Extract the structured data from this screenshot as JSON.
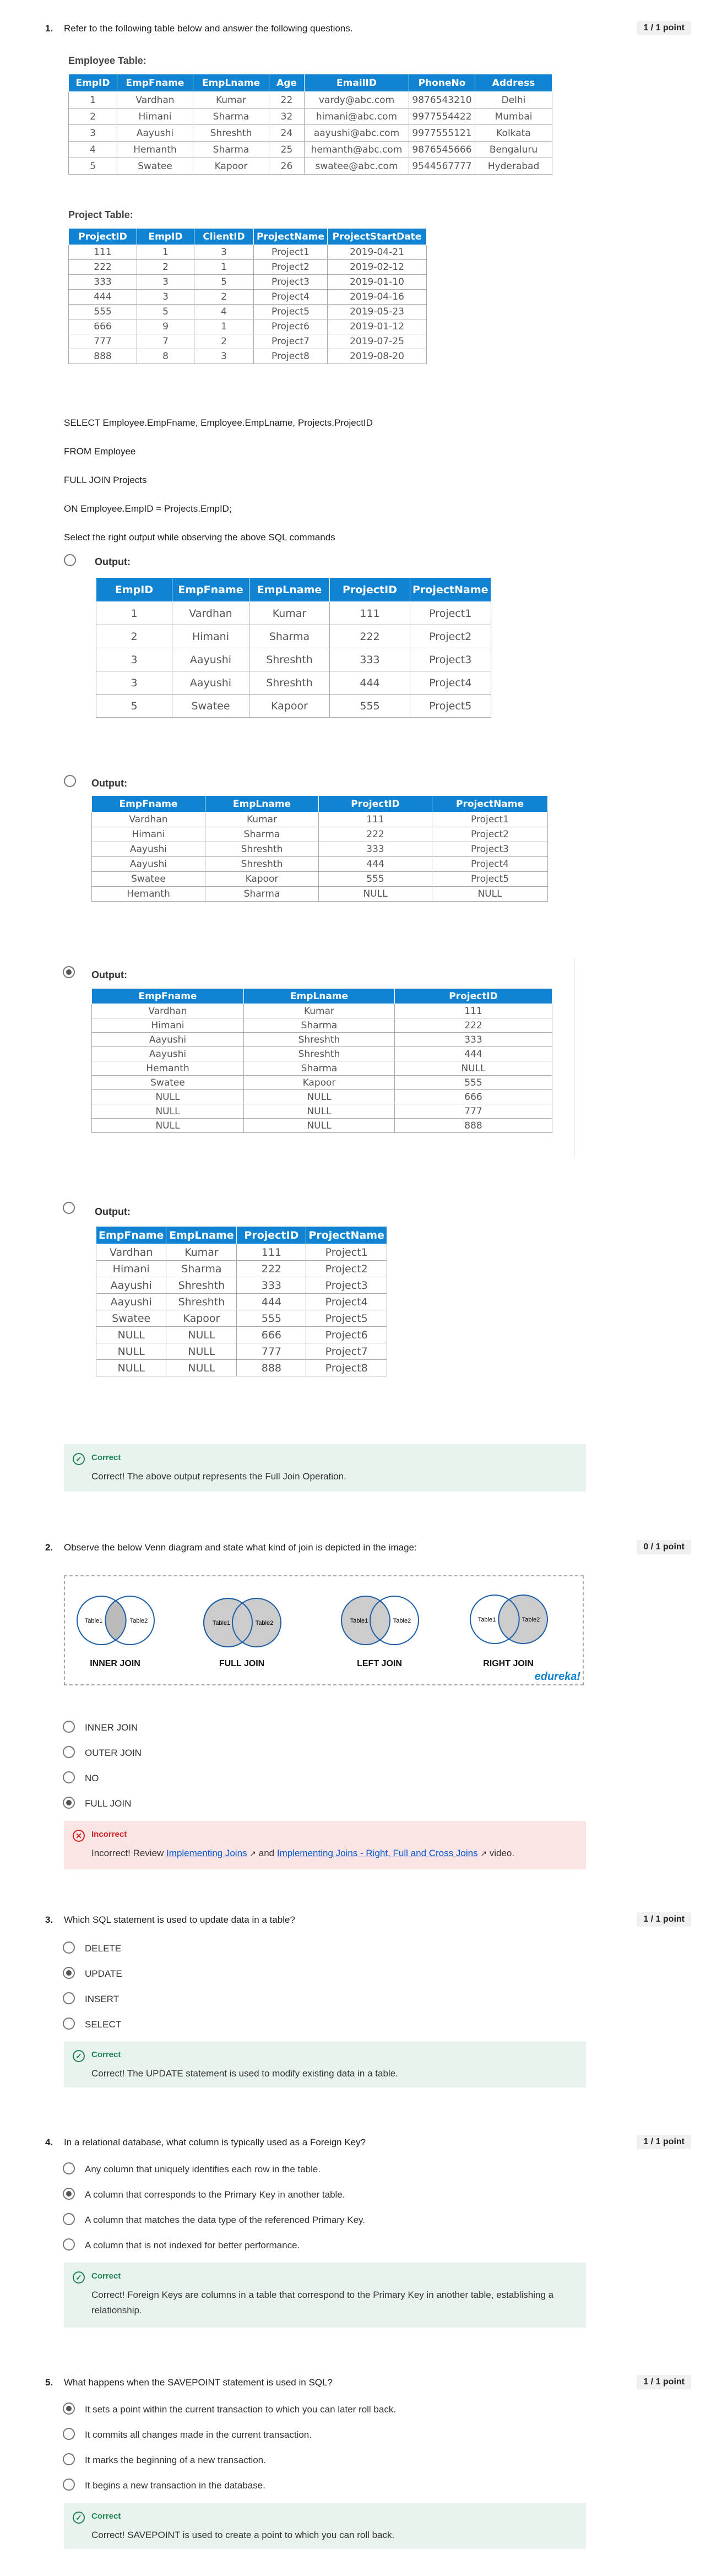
{
  "q1": {
    "number": "1.",
    "question": "Refer to the following table below and answer the following questions.",
    "points": "1 / 1 point",
    "employee_table": {
      "title": "Employee Table:",
      "headers": [
        "EmpID",
        "EmpFname",
        "EmpLname",
        "Age",
        "EmailID",
        "PhoneNo",
        "Address"
      ],
      "rows": [
        [
          "1",
          "Vardhan",
          "Kumar",
          "22",
          "vardy@abc.com",
          "9876543210",
          "Delhi"
        ],
        [
          "2",
          "Himani",
          "Sharma",
          "32",
          "himani@abc.com",
          "9977554422",
          "Mumbai"
        ],
        [
          "3",
          "Aayushi",
          "Shreshth",
          "24",
          "aayushi@abc.com",
          "9977555121",
          "Kolkata"
        ],
        [
          "4",
          "Hemanth",
          "Sharma",
          "25",
          "hemanth@abc.com",
          "9876545666",
          "Bengaluru"
        ],
        [
          "5",
          "Swatee",
          "Kapoor",
          "26",
          "swatee@abc.com",
          "9544567777",
          "Hyderabad"
        ]
      ]
    },
    "project_table": {
      "title": "Project Table:",
      "headers": [
        "ProjectID",
        "EmpID",
        "ClientID",
        "ProjectName",
        "ProjectStartDate"
      ],
      "rows": [
        [
          "111",
          "1",
          "3",
          "Project1",
          "2019-04-21"
        ],
        [
          "222",
          "2",
          "1",
          "Project2",
          "2019-02-12"
        ],
        [
          "333",
          "3",
          "5",
          "Project3",
          "2019-01-10"
        ],
        [
          "444",
          "3",
          "2",
          "Project4",
          "2019-04-16"
        ],
        [
          "555",
          "5",
          "4",
          "Project5",
          "2019-05-23"
        ],
        [
          "666",
          "9",
          "1",
          "Project6",
          "2019-01-12"
        ],
        [
          "777",
          "7",
          "2",
          "Project7",
          "2019-07-25"
        ],
        [
          "888",
          "8",
          "3",
          "Project8",
          "2019-08-20"
        ]
      ]
    },
    "sql": [
      "SELECT Employee.EmpFname, Employee.EmpLname, Projects.ProjectID",
      "FROM Employee",
      "FULL JOIN Projects",
      "ON Employee.EmpID = Projects.EmpID;",
      "Select the right output while observing the above SQL commands"
    ],
    "options": [
      {
        "label": "Output:",
        "selected": false,
        "headers": [
          "EmpID",
          "EmpFname",
          "EmpLname",
          "ProjectID",
          "ProjectName"
        ],
        "rows": [
          [
            "1",
            "Vardhan",
            "Kumar",
            "111",
            "Project1"
          ],
          [
            "2",
            "Himani",
            "Sharma",
            "222",
            "Project2"
          ],
          [
            "3",
            "Aayushi",
            "Shreshth",
            "333",
            "Project3"
          ],
          [
            "3",
            "Aayushi",
            "Shreshth",
            "444",
            "Project4"
          ],
          [
            "5",
            "Swatee",
            "Kapoor",
            "555",
            "Project5"
          ]
        ]
      },
      {
        "label": "Output:",
        "selected": false,
        "headers": [
          "EmpFname",
          "EmpLname",
          "ProjectID",
          "ProjectName"
        ],
        "rows": [
          [
            "Vardhan",
            "Kumar",
            "111",
            "Project1"
          ],
          [
            "Himani",
            "Sharma",
            "222",
            "Project2"
          ],
          [
            "Aayushi",
            "Shreshth",
            "333",
            "Project3"
          ],
          [
            "Aayushi",
            "Shreshth",
            "444",
            "Project4"
          ],
          [
            "Swatee",
            "Kapoor",
            "555",
            "Project5"
          ],
          [
            "Hemanth",
            "Sharma",
            "NULL",
            "NULL"
          ]
        ]
      },
      {
        "label": "Output:",
        "selected": true,
        "headers": [
          "EmpFname",
          "EmpLname",
          "ProjectID"
        ],
        "rows": [
          [
            "Vardhan",
            "Kumar",
            "111"
          ],
          [
            "Himani",
            "Sharma",
            "222"
          ],
          [
            "Aayushi",
            "Shreshth",
            "333"
          ],
          [
            "Aayushi",
            "Shreshth",
            "444"
          ],
          [
            "Hemanth",
            "Sharma",
            "NULL"
          ],
          [
            "Swatee",
            "Kapoor",
            "555"
          ],
          [
            "NULL",
            "NULL",
            "666"
          ],
          [
            "NULL",
            "NULL",
            "777"
          ],
          [
            "NULL",
            "NULL",
            "888"
          ]
        ]
      },
      {
        "label": "Output:",
        "selected": false,
        "headers": [
          "EmpFname",
          "EmpLname",
          "ProjectID",
          "ProjectName"
        ],
        "rows": [
          [
            "Vardhan",
            "Kumar",
            "111",
            "Project1"
          ],
          [
            "Himani",
            "Sharma",
            "222",
            "Project2"
          ],
          [
            "Aayushi",
            "Shreshth",
            "333",
            "Project3"
          ],
          [
            "Aayushi",
            "Shreshth",
            "444",
            "Project4"
          ],
          [
            "Swatee",
            "Kapoor",
            "555",
            "Project5"
          ],
          [
            "NULL",
            "NULL",
            "666",
            "Project6"
          ],
          [
            "NULL",
            "NULL",
            "777",
            "Project7"
          ],
          [
            "NULL",
            "NULL",
            "888",
            "Project8"
          ]
        ]
      }
    ],
    "feedback": {
      "status": "Correct",
      "message": "Correct! The above output represents the Full Join Operation."
    }
  },
  "q2": {
    "number": "2.",
    "question": "Observe the below Venn diagram and state what kind of join is depicted in the image:",
    "points": "0 / 1 point",
    "venn": {
      "table1": "Table1",
      "table2": "Table2",
      "labels": [
        "INNER JOIN",
        "FULL JOIN",
        "LEFT JOIN",
        "RIGHT JOIN"
      ],
      "brand": "edureka!"
    },
    "options": [
      {
        "text": "INNER JOIN",
        "selected": false
      },
      {
        "text": "OUTER JOIN",
        "selected": false
      },
      {
        "text": "NO",
        "selected": false
      },
      {
        "text": "FULL JOIN",
        "selected": true
      }
    ],
    "feedback": {
      "status": "Incorrect",
      "prefix": "Incorrect! Review",
      "link1": "Implementing Joins",
      "and": "and",
      "link2": "Implementing Joins - Right, Full and Cross Joins",
      "suffix": "video."
    }
  },
  "q3": {
    "number": "3.",
    "question": "Which SQL statement is used to update data in a table?",
    "points": "1 / 1 point",
    "options": [
      {
        "text": "DELETE",
        "selected": false
      },
      {
        "text": "UPDATE",
        "selected": true
      },
      {
        "text": "INSERT",
        "selected": false
      },
      {
        "text": "SELECT",
        "selected": false
      }
    ],
    "feedback": {
      "status": "Correct",
      "message": "Correct! The UPDATE statement is used to modify existing data in a table."
    }
  },
  "q4": {
    "number": "4.",
    "question": "In a relational database, what column is typically used as a Foreign Key?",
    "points": "1 / 1 point",
    "options": [
      {
        "text": "Any column that uniquely identifies each row in the table.",
        "selected": false
      },
      {
        "text": "A column that corresponds to the Primary Key in another table.",
        "selected": true
      },
      {
        "text": "A column that matches the data type of the referenced Primary Key.",
        "selected": false
      },
      {
        "text": "A column that is not indexed for better performance.",
        "selected": false
      }
    ],
    "feedback": {
      "status": "Correct",
      "message": "Correct! Foreign Keys are columns in a table that correspond to the Primary Key in another table, establishing a relationship."
    }
  },
  "q5": {
    "number": "5.",
    "question": "What happens when the SAVEPOINT statement is used in SQL?",
    "points": "1 / 1 point",
    "options": [
      {
        "text": "It sets a point within the current transaction to which you can later roll back.",
        "selected": true
      },
      {
        "text": "It commits all changes made in the current transaction.",
        "selected": false
      },
      {
        "text": "It marks the beginning of a new transaction.",
        "selected": false
      },
      {
        "text": "It begins a new transaction in the database.",
        "selected": false
      }
    ],
    "feedback": {
      "status": "Correct",
      "message": "Correct! SAVEPOINT is used to create a point to which you can roll back."
    }
  }
}
